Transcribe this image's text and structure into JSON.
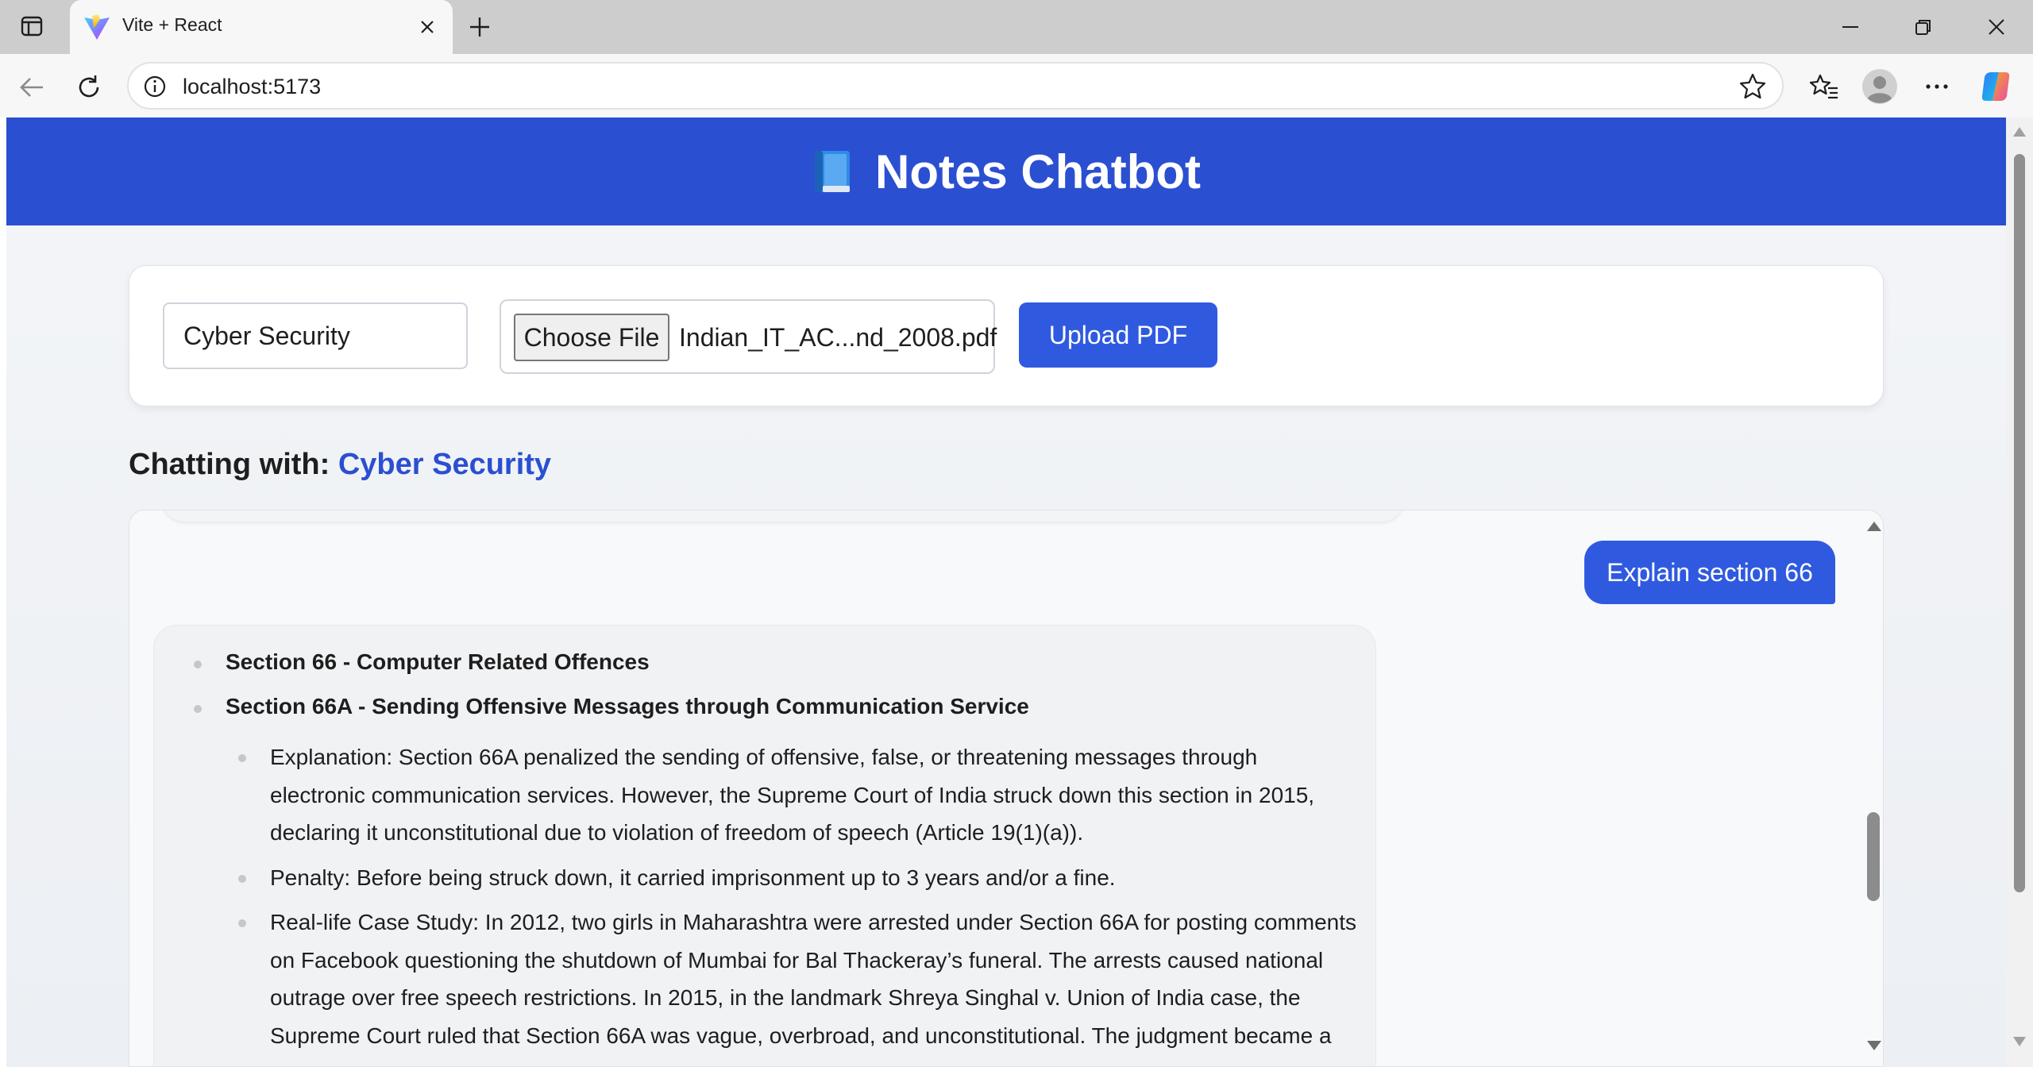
{
  "browser": {
    "tab_title": "Vite + React",
    "url": "localhost:5173"
  },
  "app": {
    "title": "Notes Chatbot",
    "accent_color": "#2b4fd1"
  },
  "upload": {
    "topic_value": "Cyber Security",
    "choose_file_label": "Choose File",
    "file_name": "Indian_IT_AC...nd_2008.pdf",
    "upload_button_label": "Upload PDF"
  },
  "chat": {
    "chatting_label": "Chatting with:",
    "topic": "Cyber Security",
    "user_message": "Explain section 66",
    "bot_items": [
      {
        "text": "Section 66 - Computer Related Offences",
        "level": 1
      },
      {
        "text": "Section 66A - Sending Offensive Messages through Communication Service",
        "level": 1
      },
      {
        "text": "Explanation: Section 66A penalized the sending of offensive, false, or threatening messages through electronic communication services. However, the Supreme Court of India struck down this section in 2015, declaring it unconstitutional due to violation of freedom of speech (Article 19(1)(a)).",
        "level": 2
      },
      {
        "text": "Penalty: Before being struck down, it carried imprisonment up to 3 years and/or a fine.",
        "level": 2
      },
      {
        "text": "Real-life Case Study: In 2012, two girls in Maharashtra were arrested under Section 66A for posting comments on Facebook questioning the shutdown of Mumbai for Bal Thackeray’s funeral. The arrests caused national outrage over free speech restrictions. In 2015, in the landmark Shreya Singhal v. Union of India case, the Supreme Court ruled that Section 66A was vague, overbroad, and unconstitutional. The judgment became a",
        "level": 2
      }
    ]
  },
  "icons": [
    "sidebar-toggle-icon",
    "vite-logo-icon",
    "close-icon",
    "plus-icon",
    "minimize-icon",
    "restore-icon",
    "back-arrow-icon",
    "reload-icon",
    "info-icon",
    "star-icon",
    "favorites-icon",
    "profile-icon",
    "more-icon",
    "copilot-icon",
    "book-icon"
  ]
}
